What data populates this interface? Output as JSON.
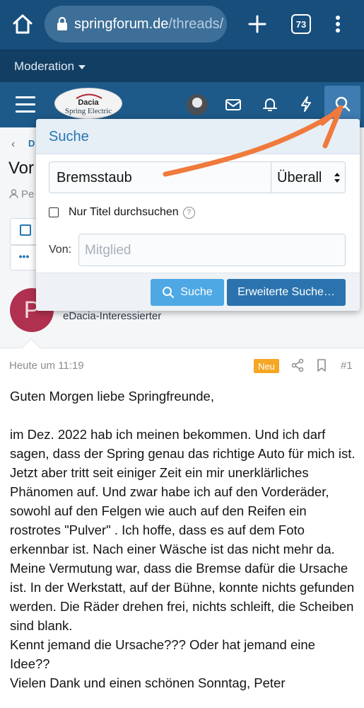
{
  "browser": {
    "url_domain": "springforum.de",
    "url_path": "/threads/",
    "tab_count": "73",
    "icons": [
      "home-icon",
      "lock-icon",
      "plus-icon",
      "tabs-icon",
      "more-icon"
    ]
  },
  "moderation": {
    "label": "Moderation"
  },
  "header": {
    "logo_line1": "Dacia",
    "logo_line2": "Spring Electric",
    "icons": [
      "menu-icon",
      "avatar",
      "mail-icon",
      "bell-icon",
      "bolt-icon",
      "search-icon"
    ]
  },
  "page_under": {
    "breadcrumb_back": "‹",
    "breadcrumb": "D",
    "title": "Vor",
    "meta": "Pe",
    "more_dots": "•••"
  },
  "user": {
    "avatar_letter": "P",
    "user_title": "eDacia-Interessierter"
  },
  "post": {
    "date": "Heute um 11:19",
    "badge": "Neu",
    "number": "#1",
    "greeting": "Guten Morgen liebe Springfreunde,",
    "body": "im Dez. 2022 hab ich meinen bekommen. Und ich darf sagen, dass der Spring genau das richtige Auto für mich ist. Jetzt aber tritt seit einiger Zeit ein mir unerklärliches Phänomen auf. Und zwar habe ich auf den Vorderäder, sowohl auf den Felgen wie auch auf den Reifen ein rostrotes \"Pulver\" . Ich hoffe, dass es auf dem Foto erkennbar ist. Nach einer Wäsche ist das nicht mehr da. Meine Vermutung war, dass die Bremse dafür die Ursache ist. In der Werkstatt, auf der Bühne, konnte nichts gefunden werden. Die Räder drehen frei, nichts schleift, die Scheiben sind blank.",
    "question": "Kennt jemand die Ursache??? Oder hat jemand eine Idee??",
    "closing": "Vielen Dank und einen schönen Sonntag, Peter"
  },
  "search": {
    "title": "Suche",
    "query": "Bremsstaub",
    "scope": "Überall",
    "title_only_label": "Nur Titel durchsuchen",
    "title_only_checked": false,
    "help": "?",
    "from_label": "Von:",
    "member_placeholder": "Mitglied",
    "submit_label": "Suche",
    "advanced_label": "Erweiterte Suche…"
  },
  "colors": {
    "browser_bar": "#174e7c",
    "site_header": "#1d5a8a",
    "accent": "#2577b1",
    "button_primary": "#4ea8e4",
    "button_secondary": "#2b73ae",
    "badge": "#f5a623",
    "annotation": "#f07a3c"
  }
}
